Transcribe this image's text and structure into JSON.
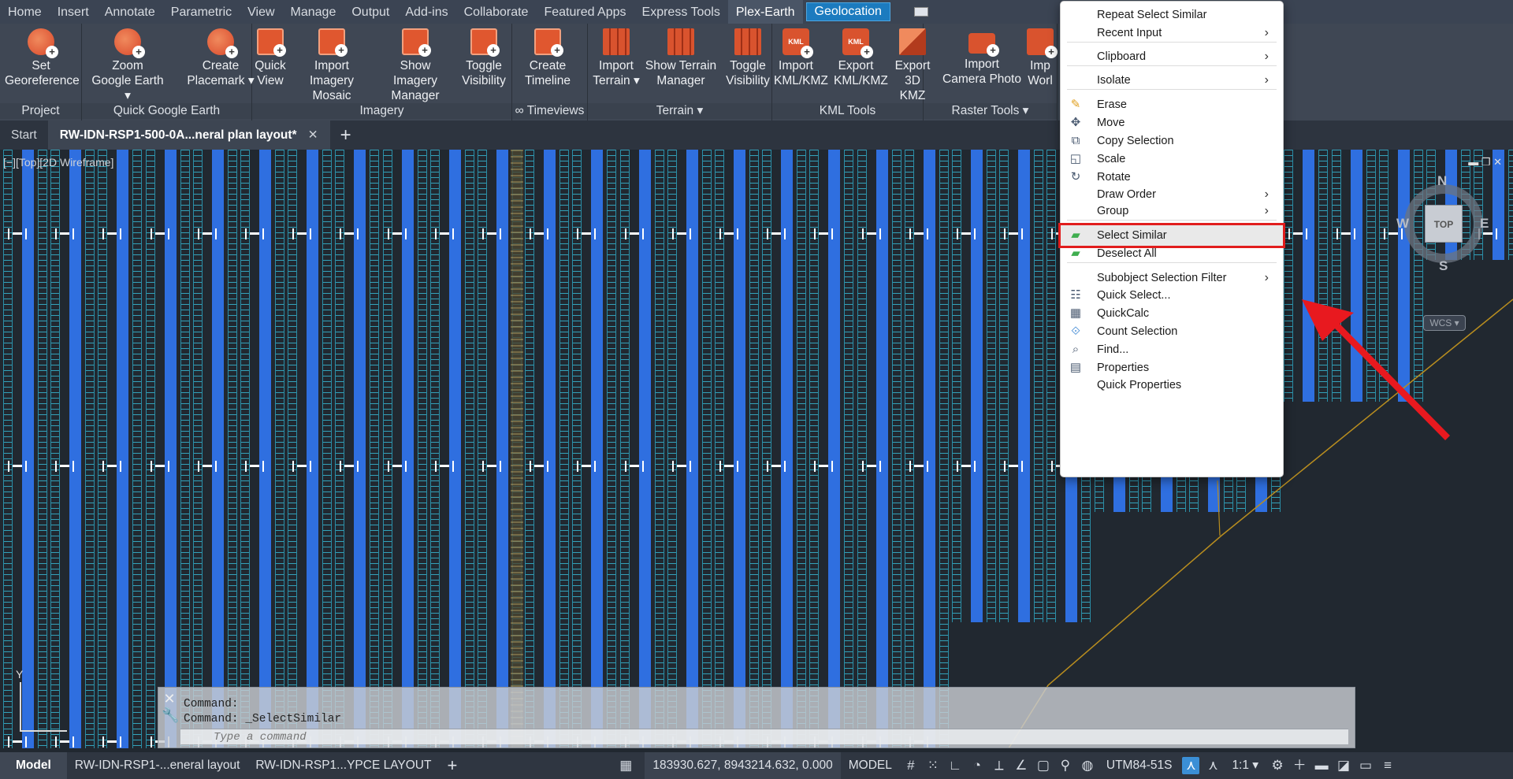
{
  "ribbon_tabs": [
    "Home",
    "Insert",
    "Annotate",
    "Parametric",
    "View",
    "Manage",
    "Output",
    "Add-ins",
    "Collaborate",
    "Featured Apps",
    "Express Tools",
    "Plex-Earth",
    "Geolocation"
  ],
  "active_tab": "Plex-Earth",
  "panels": [
    {
      "title": "Project",
      "buttons": [
        {
          "line1": "Set",
          "line2": "Georeference",
          "icon": "georeference-icon"
        }
      ]
    },
    {
      "title": "Quick Google Earth",
      "buttons": [
        {
          "line1": "Zoom",
          "line2": "Google Earth ▾",
          "icon": "zoom-google-earth-icon"
        },
        {
          "line1": "Create",
          "line2": "Placemark ▾",
          "icon": "placemark-icon"
        }
      ]
    },
    {
      "title": "Imagery",
      "buttons": [
        {
          "line1": "Quick",
          "line2": "View",
          "icon": "quick-view-icon"
        },
        {
          "line1": "Import Imagery",
          "line2": "Mosaic",
          "icon": "import-imagery-icon"
        },
        {
          "line1": "Show Imagery",
          "line2": "Manager",
          "icon": "imagery-manager-icon"
        },
        {
          "line1": "Toggle",
          "line2": "Visibility",
          "icon": "toggle-visibility-icon"
        }
      ]
    },
    {
      "title": "∞ Timeviews",
      "buttons": [
        {
          "line1": "Create",
          "line2": "Timeline",
          "icon": "timeline-icon"
        }
      ]
    },
    {
      "title": "Terrain ▾",
      "buttons": [
        {
          "line1": "Import",
          "line2": "Terrain ▾",
          "icon": "import-terrain-icon"
        },
        {
          "line1": "Show Terrain",
          "line2": "Manager",
          "icon": "terrain-manager-icon"
        },
        {
          "line1": "Toggle",
          "line2": "Visibility",
          "icon": "terrain-visibility-icon"
        }
      ]
    },
    {
      "title": "KML Tools",
      "buttons": [
        {
          "line1": "Import",
          "line2": "KML/KMZ",
          "icon": "import-kml-icon"
        },
        {
          "line1": "Export",
          "line2": "KML/KMZ",
          "icon": "export-kml-icon"
        },
        {
          "line1": "Export",
          "line2": "3D KMZ",
          "icon": "export-3d-kmz-icon"
        }
      ]
    },
    {
      "title": "Raster Tools ▾",
      "buttons": [
        {
          "line1": "Import",
          "line2": "Camera Photo",
          "icon": "camera-photo-icon"
        },
        {
          "line1": "Imp",
          "line2": "Worl",
          "icon": "import-world-icon"
        }
      ]
    }
  ],
  "doc_tabs": {
    "start": "Start",
    "active": "RW-IDN-RSP1-500-0A...neral plan layout*",
    "close": "✕",
    "add": "+"
  },
  "viewport_label": "[−][Top][2D Wireframe]",
  "viewport_controls": "▬ ❐ ✕",
  "viewcube": {
    "top": "TOP",
    "n": "N",
    "s": "S",
    "w": "W",
    "e": "E",
    "wcs": "WCS ▾"
  },
  "command": {
    "line1": "Command:",
    "line2": "Command: _SelectSimilar",
    "placeholder": "Type a command"
  },
  "ucs": {
    "y": "Y"
  },
  "status": {
    "model_tab": "Model",
    "layout1": "RW-IDN-RSP1-...eneral layout",
    "layout2": "RW-IDN-RSP1...YPCE LAYOUT",
    "add": "+",
    "coords": "183930.627, 8943214.632, 0.000",
    "space": "MODEL",
    "crs": "UTM84-51S",
    "scale": "1:1 ▾"
  },
  "context_menu": [
    {
      "label": "Repeat Select Similar",
      "icon": "",
      "arrow": false
    },
    {
      "label": "Recent Input",
      "icon": "",
      "arrow": true
    },
    {
      "label": "Clipboard",
      "icon": "",
      "arrow": true
    },
    {
      "label": "Isolate",
      "icon": "",
      "arrow": true
    },
    {
      "label": "Erase",
      "icon": "eraser-icon",
      "arrow": false
    },
    {
      "label": "Move",
      "icon": "move-icon",
      "arrow": false
    },
    {
      "label": "Copy Selection",
      "icon": "copy-icon",
      "arrow": false
    },
    {
      "label": "Scale",
      "icon": "scale-icon",
      "arrow": false
    },
    {
      "label": "Rotate",
      "icon": "rotate-icon",
      "arrow": false
    },
    {
      "label": "Draw Order",
      "icon": "",
      "arrow": true
    },
    {
      "label": "Group",
      "icon": "",
      "arrow": true
    },
    {
      "label": "Select Similar",
      "icon": "select-similar-icon",
      "arrow": false
    },
    {
      "label": "Deselect All",
      "icon": "deselect-all-icon",
      "arrow": false
    },
    {
      "label": "Subobject Selection Filter",
      "icon": "",
      "arrow": true
    },
    {
      "label": "Quick Select...",
      "icon": "quick-select-icon",
      "arrow": false
    },
    {
      "label": "QuickCalc",
      "icon": "calculator-icon",
      "arrow": false
    },
    {
      "label": "Count Selection",
      "icon": "count-icon",
      "arrow": false
    },
    {
      "label": "Find...",
      "icon": "find-icon",
      "arrow": false
    },
    {
      "label": "Properties",
      "icon": "properties-icon",
      "arrow": false
    },
    {
      "label": "Quick Properties",
      "icon": "",
      "arrow": false
    }
  ],
  "highlighted_item": "Select Similar",
  "colors": {
    "highlight_box": "#e11d1d",
    "annotation_arrow": "#e8191f",
    "panel_strip": "#2f6fe0",
    "table_strip": "#37b0c9"
  }
}
